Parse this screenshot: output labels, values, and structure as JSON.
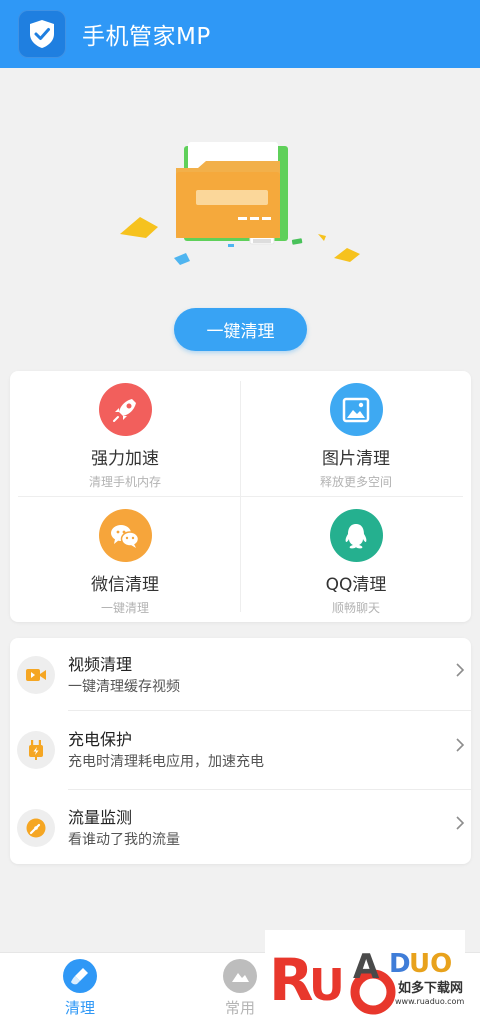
{
  "header": {
    "title": "手机管家MP",
    "logo_icon": "shield-check-icon"
  },
  "hero": {
    "illustration": "folder-icon",
    "button_label": "一键清理"
  },
  "grid": [
    {
      "title": "强力加速",
      "subtitle": "清理手机内存",
      "icon": "rocket-icon",
      "color": "#f25f5c"
    },
    {
      "title": "图片清理",
      "subtitle": "释放更多空间",
      "icon": "image-icon",
      "color": "#3ea9f2"
    },
    {
      "title": "微信清理",
      "subtitle": "一键清理",
      "icon": "wechat-icon",
      "color": "#f6a53b"
    },
    {
      "title": "QQ清理",
      "subtitle": "顺畅聊天",
      "icon": "qq-icon",
      "color": "#25b08f"
    }
  ],
  "list": [
    {
      "title": "视频清理",
      "subtitle": "一键清理缓存视频",
      "icon": "video-icon"
    },
    {
      "title": "充电保护",
      "subtitle": "充电时清理耗电应用，加速充电",
      "icon": "charge-plug-icon"
    },
    {
      "title": "流量监测",
      "subtitle": "看谁动了我的流量",
      "icon": "traffic-gauge-icon"
    }
  ],
  "tabs": [
    {
      "label": "清理",
      "icon": "broom-icon",
      "active": true
    },
    {
      "label": "常用",
      "icon": "common-icon",
      "active": false
    }
  ],
  "colors": {
    "primary": "#2f98f6",
    "accent_icon": "#f5a623",
    "inactive": "#b5b5b5"
  },
  "watermark": {
    "brand": "RUANDUO",
    "text": "如多下载网",
    "url": "www.ruaduo.com"
  }
}
